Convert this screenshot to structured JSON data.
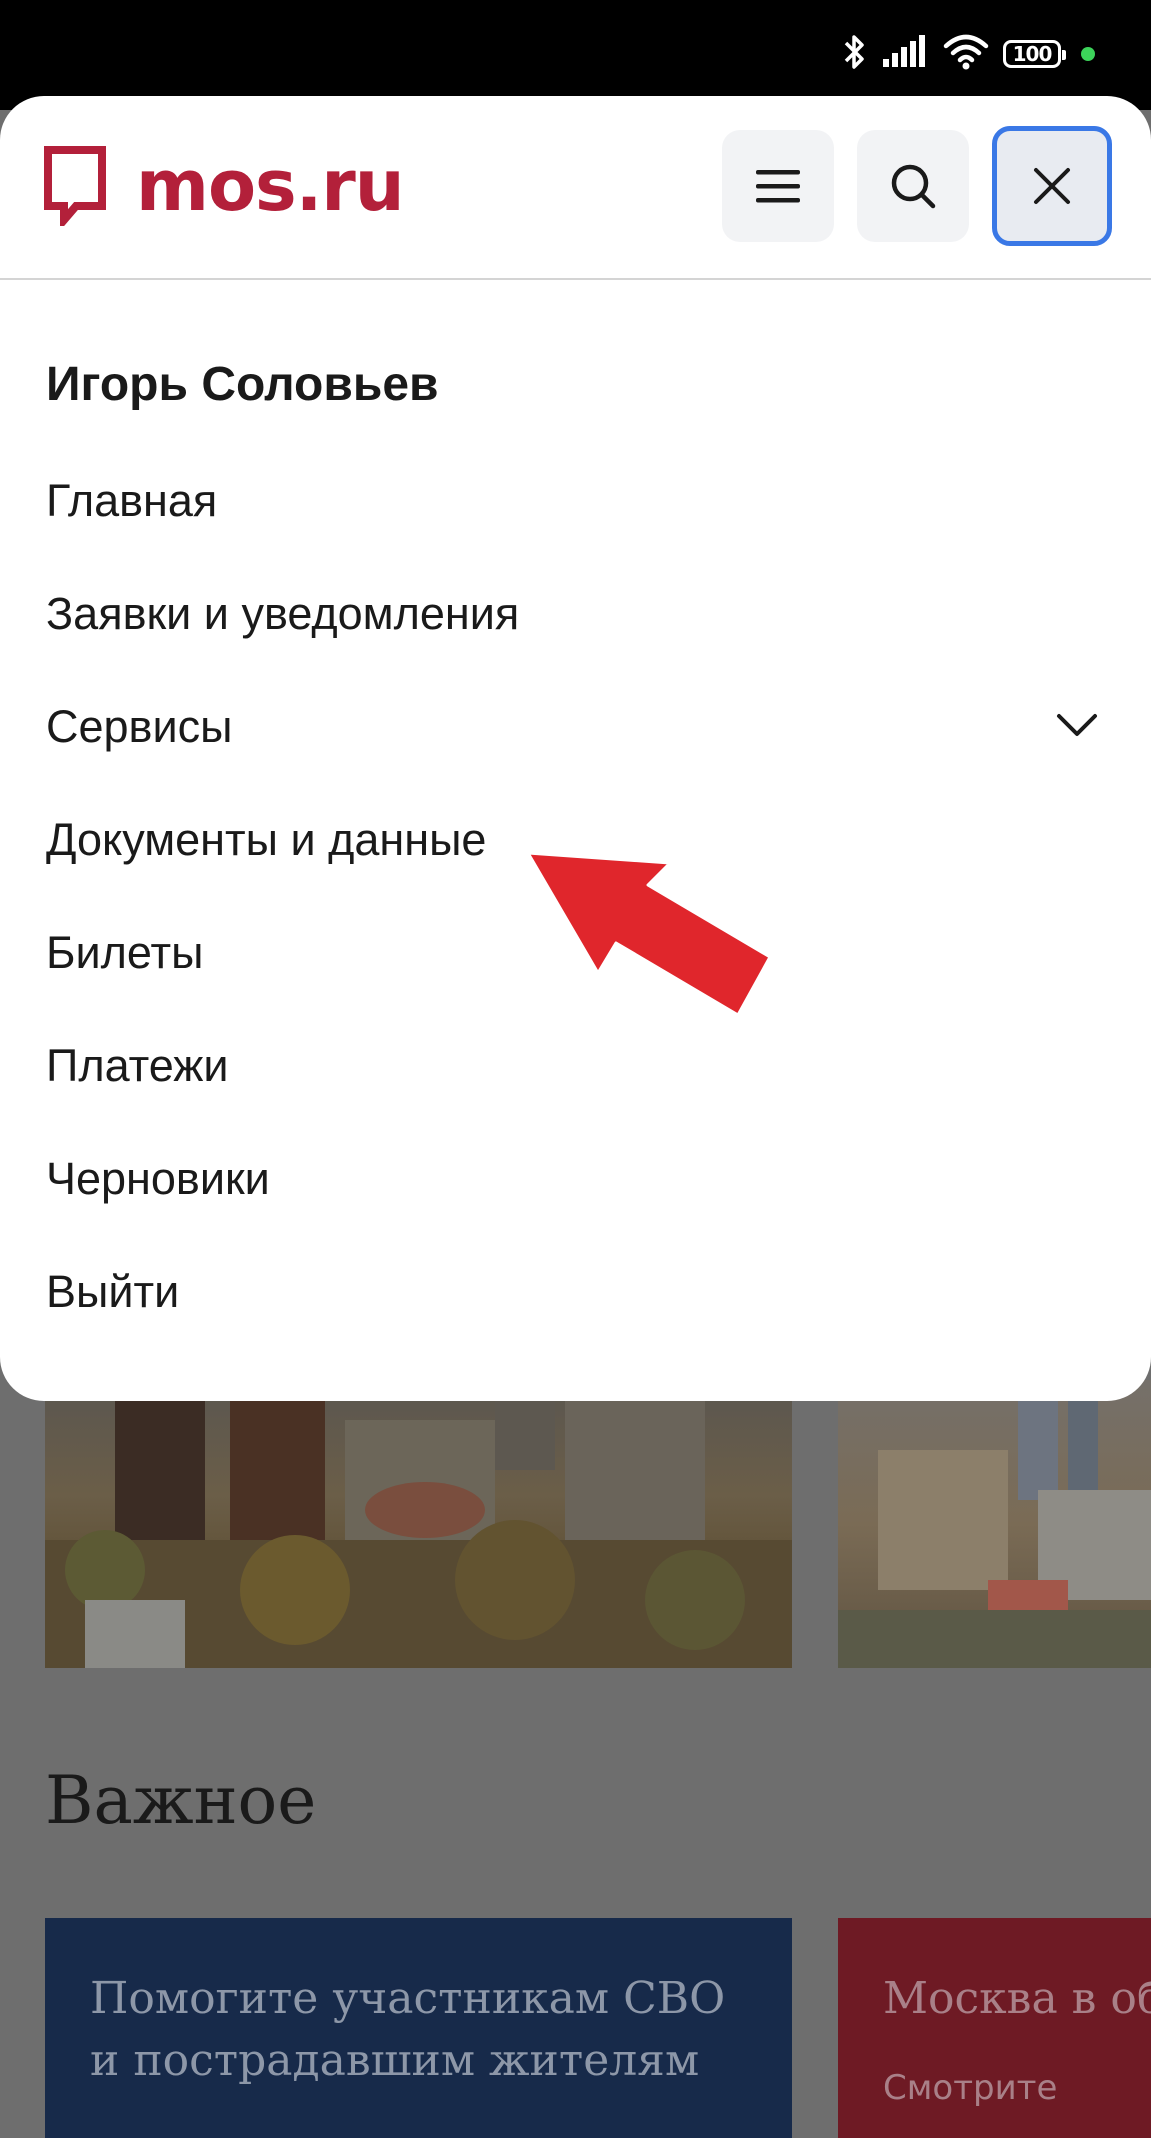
{
  "status_bar": {
    "battery": "100",
    "icons": [
      "bluetooth-icon",
      "signal-icon",
      "wifi-icon",
      "battery-icon",
      "privacy-dot"
    ]
  },
  "header": {
    "logo_text": "mos.ru",
    "buttons": [
      "menu-icon",
      "search-icon",
      "close-icon"
    ]
  },
  "menu": {
    "user_name": "Игорь Соловьев",
    "items": [
      {
        "label": "Главная"
      },
      {
        "label": "Заявки и уведомления"
      },
      {
        "label": "Сервисы",
        "expandable": true
      },
      {
        "label": "Документы и данные"
      },
      {
        "label": "Билеты"
      },
      {
        "label": "Платежи"
      },
      {
        "label": "Черновики"
      },
      {
        "label": "Выйти"
      }
    ]
  },
  "background": {
    "section_title": "Важное",
    "cards": [
      {
        "title": "Помогите участникам СВО и пострадавшим жителям"
      },
      {
        "title": "Москва в об",
        "subtitle": "Смотрите"
      }
    ]
  },
  "colors": {
    "brand": "#b3203a",
    "focus_ring": "#3a78e6",
    "arrow": "#e0262c"
  }
}
